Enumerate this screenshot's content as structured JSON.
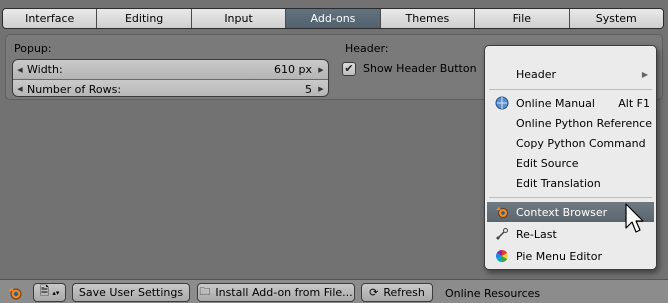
{
  "tabs": [
    {
      "label": "Interface"
    },
    {
      "label": "Editing"
    },
    {
      "label": "Input"
    },
    {
      "label": "Add-ons"
    },
    {
      "label": "Themes"
    },
    {
      "label": "File"
    },
    {
      "label": "System"
    }
  ],
  "active_tab": "Add-ons",
  "panel": {
    "popup_label": "Popup:",
    "width_label": "Width:",
    "width_value": "610 px",
    "rows_label": "Number of Rows:",
    "rows_value": "5",
    "header_label": "Header:",
    "show_header_button_label": "Show Header Button",
    "show_header_button_checked": true
  },
  "menu": {
    "items": [
      {
        "label": "Header",
        "has_submenu": true
      },
      {
        "label": "Online Manual",
        "shortcut": "Alt F1",
        "icon": "help-globe-icon"
      },
      {
        "label": "Online Python Reference"
      },
      {
        "label": "Copy Python Command"
      },
      {
        "label": "Edit Source"
      },
      {
        "label": "Edit Translation"
      },
      {
        "label": "Context Browser",
        "icon": "context-browser-icon",
        "highlighted": true
      },
      {
        "label": "Re-Last",
        "icon": "re-last-icon"
      },
      {
        "label": "Pie Menu Editor",
        "icon": "color-wheel-icon"
      }
    ],
    "highlight_color": "#5f6a73"
  },
  "bottom_bar": {
    "save_label": "Save User Settings",
    "install_label": "Install Add-on from File...",
    "refresh_label": "Refresh",
    "online_resources_label": "Online Resources"
  },
  "colors": {
    "background": "#727272",
    "active_tab": "#5a6974"
  }
}
